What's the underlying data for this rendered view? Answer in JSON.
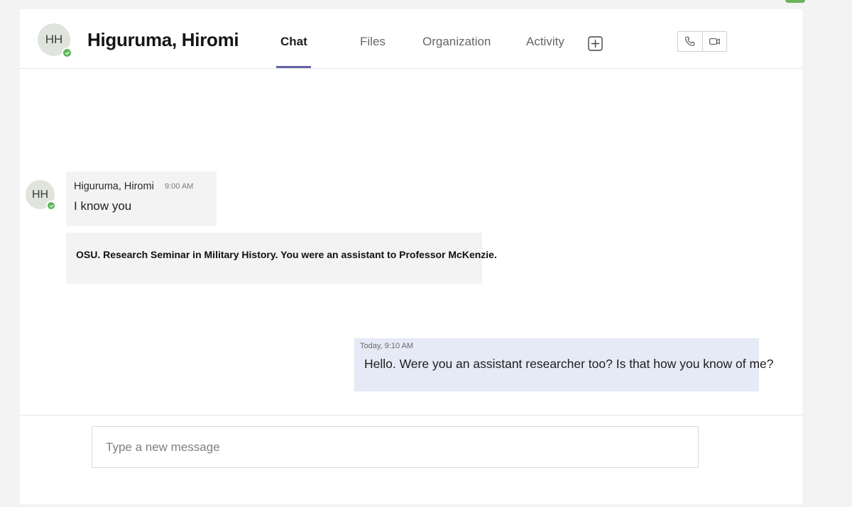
{
  "contact": {
    "initials": "HH",
    "name": "Higuruma, Hiromi",
    "status": "available"
  },
  "tabs": [
    {
      "label": "Chat",
      "active": true
    },
    {
      "label": "Files",
      "active": false
    },
    {
      "label": "Organization",
      "active": false
    },
    {
      "label": "Activity",
      "active": false
    }
  ],
  "icons": {
    "add_tab": "plus-square-icon",
    "audio_call": "phone-icon",
    "video_call": "video-camera-icon",
    "presence": "check-icon"
  },
  "messages": {
    "incoming": {
      "sender": "Higuruma, Hiromi",
      "time": "9:00 AM",
      "text": "I know you",
      "followup": "OSU. Research Seminar in Military History. You were an assistant to Professor McKenzie."
    },
    "outgoing": {
      "time": "Today, 9:10 AM",
      "text": "Hello. Were you an assistant researcher too? Is that how you know of me?"
    }
  },
  "composer": {
    "placeholder": "Type a new message",
    "value": ""
  },
  "colors": {
    "accent": "#6264a7",
    "presence": "#5db85b",
    "outgoing_bubble": "#e6e9f6",
    "incoming_bubble": "#f3f3f3"
  }
}
